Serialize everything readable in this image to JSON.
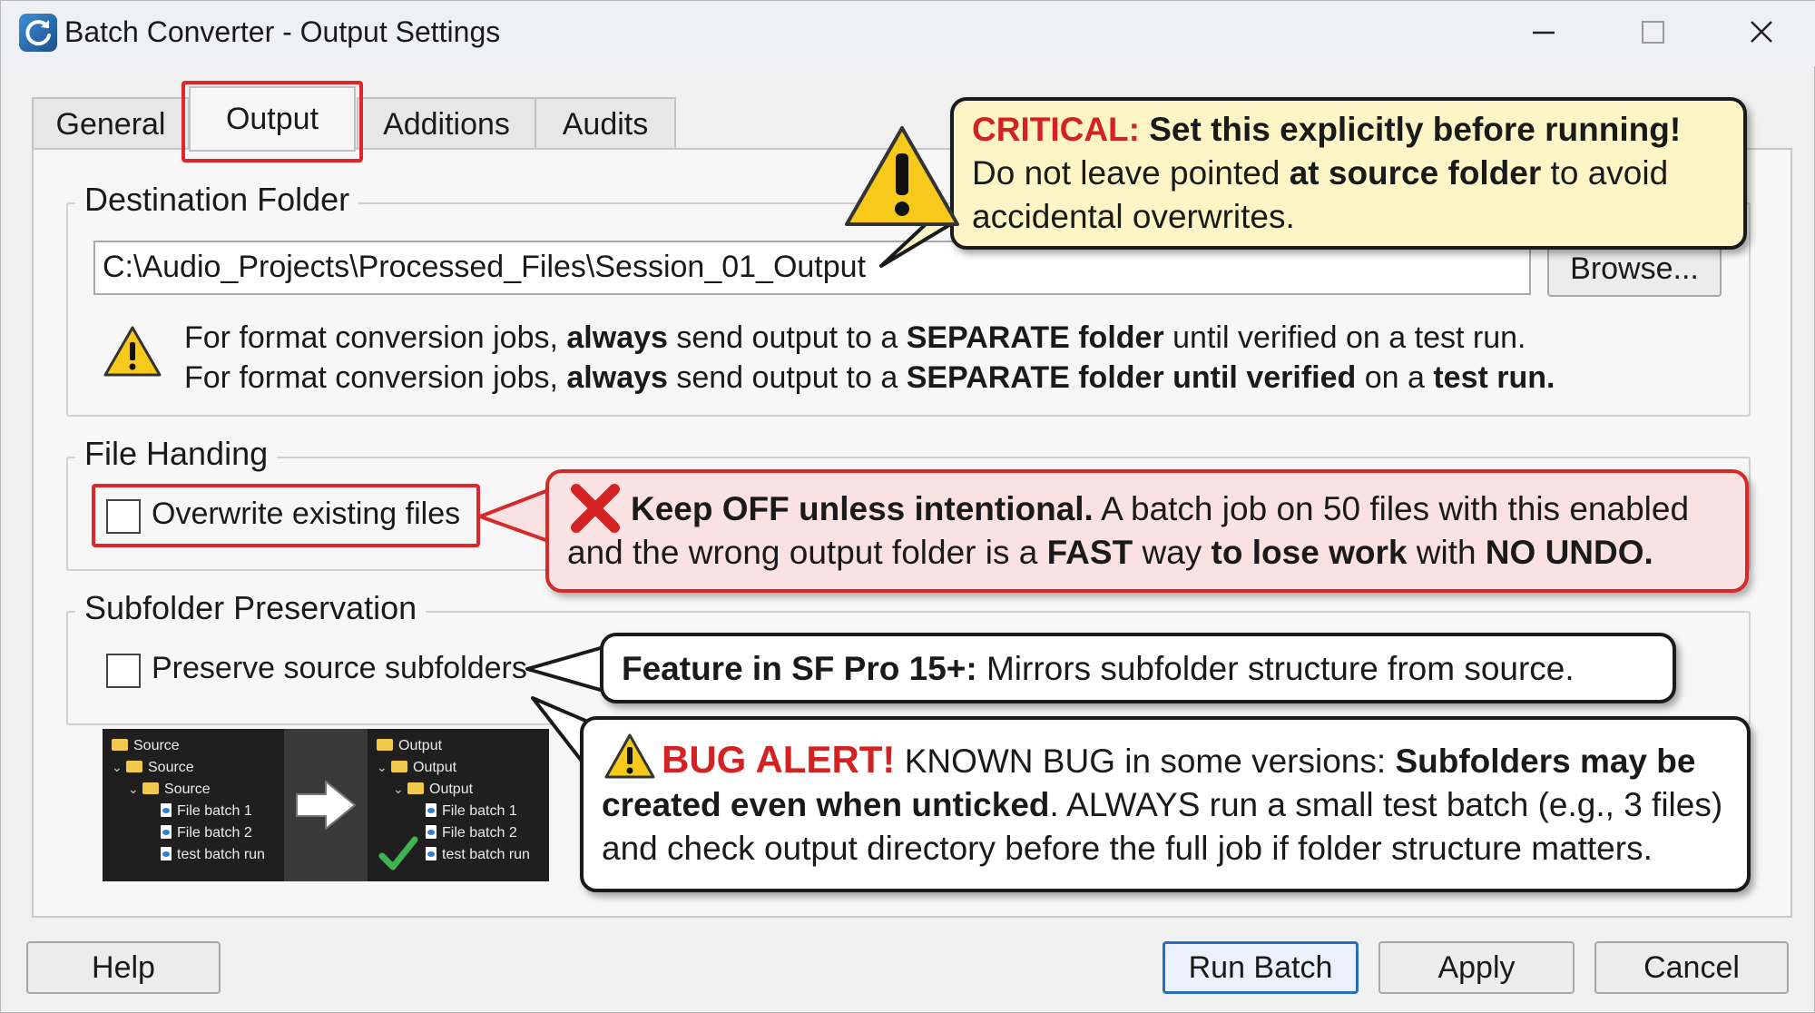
{
  "window": {
    "title": "Batch Converter - Output Settings"
  },
  "tabs": [
    {
      "label": "General"
    },
    {
      "label": "Output"
    },
    {
      "label": "Additions"
    },
    {
      "label": "Audits"
    }
  ],
  "destination": {
    "legend": "Destination Folder",
    "path_value": "C:\\Audio_Projects\\Processed_Files\\Session_01_Output",
    "browse_label": "Browse...",
    "note_line1_a": "For format conversion jobs, ",
    "note_line1_b": "always",
    "note_line1_c": " send output to a ",
    "note_line1_d": "SEPARATE folder",
    "note_line1_e": " until verified on a test run.",
    "note_line2_a": "For format conversion jobs, ",
    "note_line2_b": "always",
    "note_line2_c": " send output to a ",
    "note_line2_d": "SEPARATE folder until verified",
    "note_line2_e": " on a ",
    "note_line2_f": "test run."
  },
  "critical_callout": {
    "label": "CRITICAL:",
    "headline": " Set this explicitly before running!",
    "line2_a": "Do not leave pointed ",
    "line2_b": "at source folder",
    "line2_c": " to avoid",
    "line3": "accidental overwrites."
  },
  "file_handling": {
    "legend": "File Handing",
    "overwrite_label": "Overwrite existing files",
    "overwrite_checked": false
  },
  "overwrite_callout": {
    "headline": "Keep OFF unless intentional.",
    "line1_rest": " A batch job on 50 files with this enabled",
    "line2_a": "and the wrong output folder is a ",
    "line2_b": "FAST",
    "line2_c": " way ",
    "line2_d": "to lose work",
    "line2_e": " with ",
    "line2_f": "NO UNDO."
  },
  "subfolder": {
    "legend": "Subfolder Preservation",
    "preserve_label": "Preserve source subfolders",
    "preserve_checked": false
  },
  "feature_callout": {
    "bold": "Feature in SF Pro 15+:",
    "rest": " Mirrors subfolder structure from source."
  },
  "bug_callout": {
    "label": "BUG ALERT!",
    "line1_a": " KNOWN BUG in some versions: ",
    "line1_b": "Subfolders may be",
    "line2_a": "created even when unticked",
    "line2_b": ". ALWAYS run a small test batch (e.g., 3 files)",
    "line3": "and check output directory before the full job if folder structure matters."
  },
  "tree_example": {
    "left": [
      "Source",
      "Source",
      "Source",
      "File batch 1",
      "File batch 2",
      "test batch run"
    ],
    "right": [
      "Output",
      "Output",
      "Output",
      "File batch 1",
      "File batch 2",
      "test batch run"
    ]
  },
  "footer": {
    "help_label": "Help",
    "run_label": "Run Batch",
    "apply_label": "Apply",
    "cancel_label": "Cancel"
  },
  "colors": {
    "accent_red": "#e0262a",
    "callout_yellow": "#fdf5c6",
    "callout_red_bg": "#fbe2e2",
    "primary_button_border": "#2b6cc0"
  }
}
